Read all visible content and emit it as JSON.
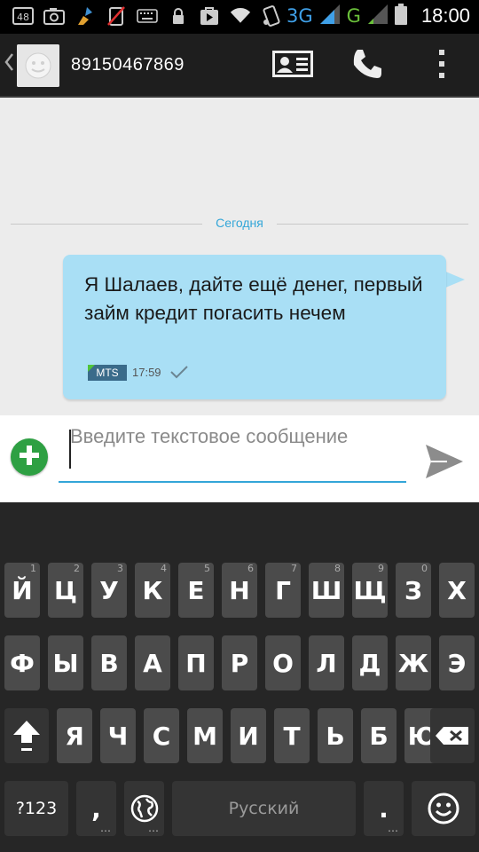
{
  "status_bar": {
    "notif_badge": "48",
    "network_3g": "3G",
    "network_g": "G",
    "time": "18:00",
    "icons": [
      "sim-card-icon",
      "camera-icon",
      "cleaner-icon",
      "no-sim-icon",
      "keyboard-icon",
      "lock-icon",
      "play-store-icon",
      "wifi-icon",
      "phone-rotate-icon",
      "signal-icon",
      "signal-icon",
      "battery-icon"
    ]
  },
  "action_bar": {
    "contact_number": "89150467869",
    "back_icon": "chevron-left-icon",
    "buttons": [
      "contact-card-icon",
      "phone-icon",
      "overflow-menu-icon"
    ]
  },
  "conversation": {
    "date_label": "Сегодня",
    "messages": [
      {
        "text": "Я Шалаев, дайте ещё денег, первый займ кредит погасить нечем",
        "sim": "MTS",
        "time": "17:59",
        "status_icon": "sent-check-icon"
      }
    ]
  },
  "compose": {
    "placeholder": "Введите текстовое сообщение",
    "attach_icon": "add-icon",
    "send_icon": "send-icon"
  },
  "keyboard": {
    "row1": [
      {
        "key": "Й",
        "hint": "1"
      },
      {
        "key": "Ц",
        "hint": "2"
      },
      {
        "key": "У",
        "hint": "3"
      },
      {
        "key": "К",
        "hint": "4"
      },
      {
        "key": "Е",
        "hint": "5"
      },
      {
        "key": "Н",
        "hint": "6"
      },
      {
        "key": "Г",
        "hint": "7"
      },
      {
        "key": "Ш",
        "hint": "8"
      },
      {
        "key": "Щ",
        "hint": "9"
      },
      {
        "key": "З",
        "hint": "0"
      },
      {
        "key": "Х",
        "hint": ""
      }
    ],
    "row2": [
      "Ф",
      "Ы",
      "В",
      "А",
      "П",
      "Р",
      "О",
      "Л",
      "Д",
      "Ж",
      "Э"
    ],
    "row3": [
      "Я",
      "Ч",
      "С",
      "М",
      "И",
      "Т",
      "Ь",
      "Б",
      "Ю"
    ],
    "symbols_label": "?123",
    "comma_label": ",",
    "space_label": "Русский",
    "period_label": ".",
    "shift_icon": "shift-icon",
    "backspace_icon": "backspace-icon",
    "language_icon": "globe-icon",
    "emoji_icon": "smiley-icon"
  },
  "colors": {
    "accent": "#33a6d8",
    "bubble": "#a9dff5",
    "attach_green": "#2ea043"
  }
}
